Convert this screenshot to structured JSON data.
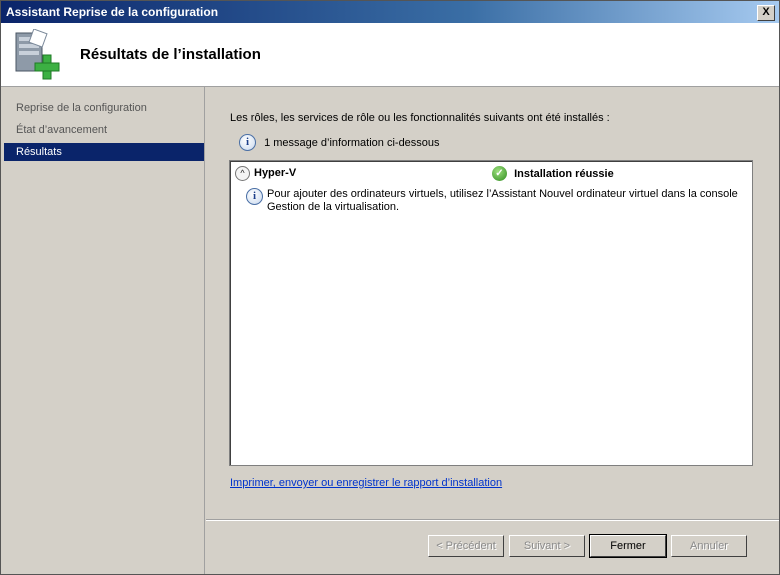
{
  "window": {
    "title": "Assistant Reprise de la configuration",
    "close_label": "X"
  },
  "header": {
    "title": "Résultats de l’installation",
    "icon": "server-add-icon"
  },
  "nav": {
    "items": [
      {
        "label": "Reprise de la configuration",
        "active": false
      },
      {
        "label": "État d’avancement",
        "active": false
      },
      {
        "label": "Résultats",
        "active": true
      }
    ]
  },
  "main": {
    "intro": "Les rôles, les services de rôle ou les fonctionnalités suivants ont été installés :",
    "info_summary": "1 message d’information ci-dessous",
    "info_icon_glyph": "i",
    "results": [
      {
        "role": "Hyper-V",
        "status": "Installation réussie",
        "message": "Pour ajouter des ordinateurs virtuels, utilisez l’Assistant Nouvel ordinateur virtuel dans la console Gestion de la virtualisation."
      }
    ],
    "collapse_glyph": "^",
    "check_glyph": "✓",
    "report_link": "Imprimer, envoyer ou enregistrer le rapport d’installation"
  },
  "buttons": {
    "previous": "< Précédent",
    "next": "Suivant >",
    "close": "Fermer",
    "cancel": "Annuler"
  },
  "colors": {
    "selection": "#0a246a",
    "link": "#0033cc",
    "success": "#2e8b1e"
  }
}
